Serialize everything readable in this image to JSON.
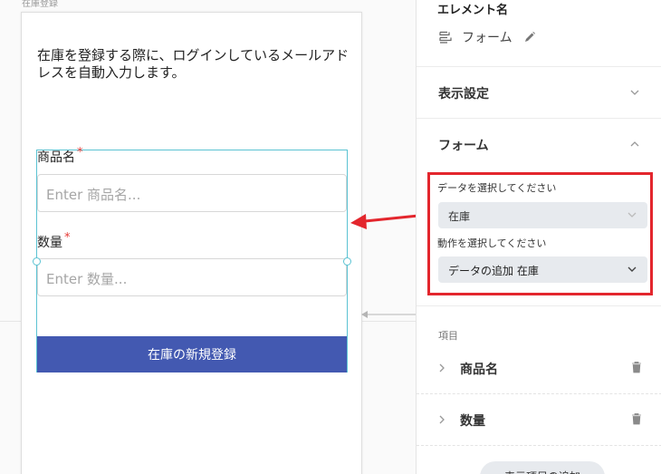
{
  "canvas": {
    "page_label": "在庫登録",
    "description": "在庫を登録する際に、ログインしているメールアドレスを自動入力します。",
    "form": {
      "fields": [
        {
          "label": "商品名",
          "required_mark": "*",
          "placeholder": "Enter 商品名..."
        },
        {
          "label": "数量",
          "required_mark": "*",
          "placeholder": "Enter 数量..."
        }
      ],
      "submit_label": "在庫の新規登録",
      "submit_color": "#4359b1"
    }
  },
  "panel": {
    "element_name_title": "エレメント名",
    "element_name": "フォーム",
    "sections": {
      "display_settings": "表示設定",
      "form": "フォーム"
    },
    "data_select_label": "データを選択してください",
    "data_select_value": "在庫",
    "action_select_label": "動作を選択してください",
    "action_select_value": "データの追加 在庫",
    "items_label": "項目",
    "items": [
      {
        "name": "商品名"
      },
      {
        "name": "数量"
      }
    ],
    "add_button": "表示項目の追加"
  },
  "colors": {
    "highlight_border": "#e3262d",
    "selection_border": "#5bc3d3",
    "submit_bg": "#4359b1"
  }
}
